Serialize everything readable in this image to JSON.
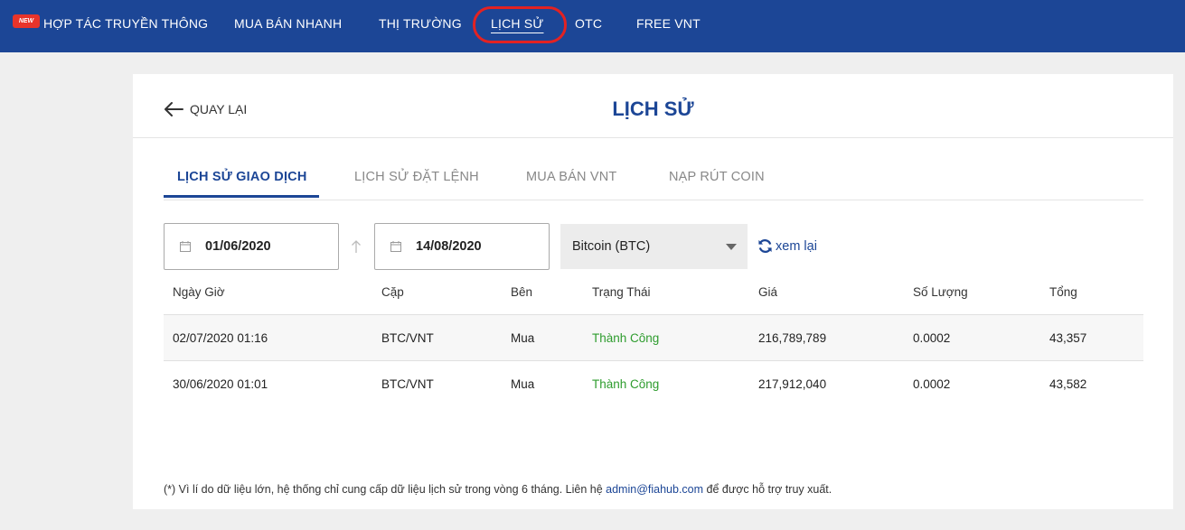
{
  "nav": {
    "badge": "NEW",
    "items": [
      {
        "label": "HỢP TÁC TRUYỀN THÔNG"
      },
      {
        "label": "MUA BÁN NHANH"
      },
      {
        "label": "THỊ TRƯỜNG"
      },
      {
        "label": "LỊCH SỬ"
      },
      {
        "label": "OTC"
      },
      {
        "label": "FREE VNT"
      }
    ],
    "active": "LỊCH SỬ"
  },
  "page": {
    "back_label": "QUAY LẠI",
    "title": "LỊCH SỬ"
  },
  "tabs": [
    {
      "label": "LỊCH SỬ GIAO DỊCH",
      "active": true
    },
    {
      "label": "LỊCH SỬ ĐẶT LỆNH",
      "active": false
    },
    {
      "label": "MUA BÁN VNT",
      "active": false
    },
    {
      "label": "NẠP RÚT COIN",
      "active": false
    }
  ],
  "filters": {
    "from_date": "01/06/2020",
    "to_date": "14/08/2020",
    "coin": "Bitcoin (BTC)",
    "reload_label": "xem lại"
  },
  "table": {
    "headers": [
      "Ngày Giờ",
      "Cặp",
      "Bên",
      "Trạng Thái",
      "Giá",
      "Số Lượng",
      "Tổng"
    ],
    "rows": [
      [
        "02/07/2020 01:16",
        "BTC/VNT",
        "Mua",
        "Thành Công",
        "216,789,789",
        "0.0002",
        "43,357"
      ],
      [
        "30/06/2020 01:01",
        "BTC/VNT",
        "Mua",
        "Thành Công",
        "217,912,040",
        "0.0002",
        "43,582"
      ]
    ]
  },
  "note": {
    "prefix": "(*) Vì lí do dữ liệu lớn, hệ thống chỉ cung cấp dữ liệu lịch sử trong vòng 6 tháng. Liên hệ ",
    "email": "admin@fiahub.com",
    "suffix": " để được hỗ trợ truy xuất."
  },
  "colors": {
    "brand": "#1c4696",
    "success": "#2e9c2e",
    "highlight": "#e32222"
  },
  "icons": [
    "new-badge",
    "arrow-left-icon",
    "calendar-icon",
    "arrow-up-icon",
    "caret-down-icon",
    "refresh-icon"
  ]
}
